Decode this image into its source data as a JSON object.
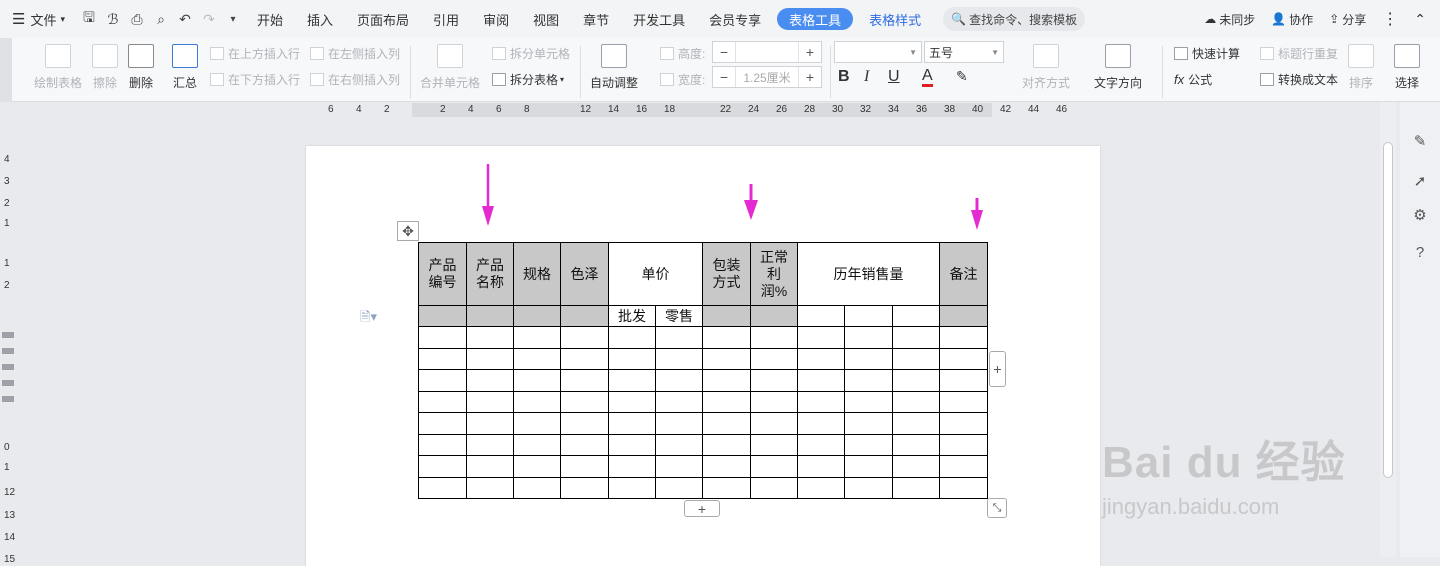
{
  "menubar": {
    "file": "文件",
    "tabs": [
      "开始",
      "插入",
      "页面布局",
      "引用",
      "审阅",
      "视图",
      "章节",
      "开发工具",
      "会员专享"
    ],
    "active_tab": "表格工具",
    "context_tab": "表格样式",
    "search_placeholder": "查找命令、搜索模板",
    "sync": "未同步",
    "collab": "协作",
    "share": "分享"
  },
  "toolbar": {
    "draw_table": "绘制表格",
    "erase": "擦除",
    "delete": "删除",
    "summary": "汇总",
    "insert_above": "在上方插入行",
    "insert_below": "在下方插入行",
    "insert_left": "在左侧插入列",
    "insert_right": "在右侧插入列",
    "merge_cells": "合并单元格",
    "split_cells": "拆分单元格",
    "split_table": "拆分表格",
    "auto_fit": "自动调整",
    "height_label": "高度:",
    "width_label": "宽度:",
    "height_value": "",
    "width_value": "1.25厘米",
    "font_name": "",
    "font_size": "五号",
    "bold": "B",
    "italic": "I",
    "underline": "U",
    "font_color": "A",
    "align": "对齐方式",
    "text_direction": "文字方向",
    "quick_calc": "快速计算",
    "repeat_header": "标题行重复",
    "formula": "公式",
    "to_text": "转换成文本",
    "sort": "排序",
    "select": "选择"
  },
  "ruler": {
    "h": [
      "6",
      "4",
      "2",
      "2",
      "4",
      "6",
      "8",
      "12",
      "14",
      "16",
      "18",
      "22",
      "24",
      "26",
      "28",
      "30",
      "32",
      "34",
      "36",
      "38",
      "40",
      "42",
      "44",
      "46"
    ],
    "v": [
      "4",
      "3",
      "2",
      "1",
      "1",
      "2",
      "0",
      "1",
      "12",
      "13",
      "14",
      "15"
    ]
  },
  "table": {
    "h_code": "产品编号",
    "h_name": "产品名称",
    "h_spec": "规格",
    "h_color": "色泽",
    "h_price": "单价",
    "h_wholesale": "批发",
    "h_retail": "零售",
    "h_pack": "包装方式",
    "h_profit": "正常利润%",
    "h_sales": "历年销售量",
    "h_note": "备注",
    "empty_rows": 8
  },
  "annotations": {
    "arrow_color": "#e62ad2",
    "count": 3
  },
  "watermark": {
    "brand": "Bai du 经验",
    "url": "jingyan.baidu.com"
  }
}
